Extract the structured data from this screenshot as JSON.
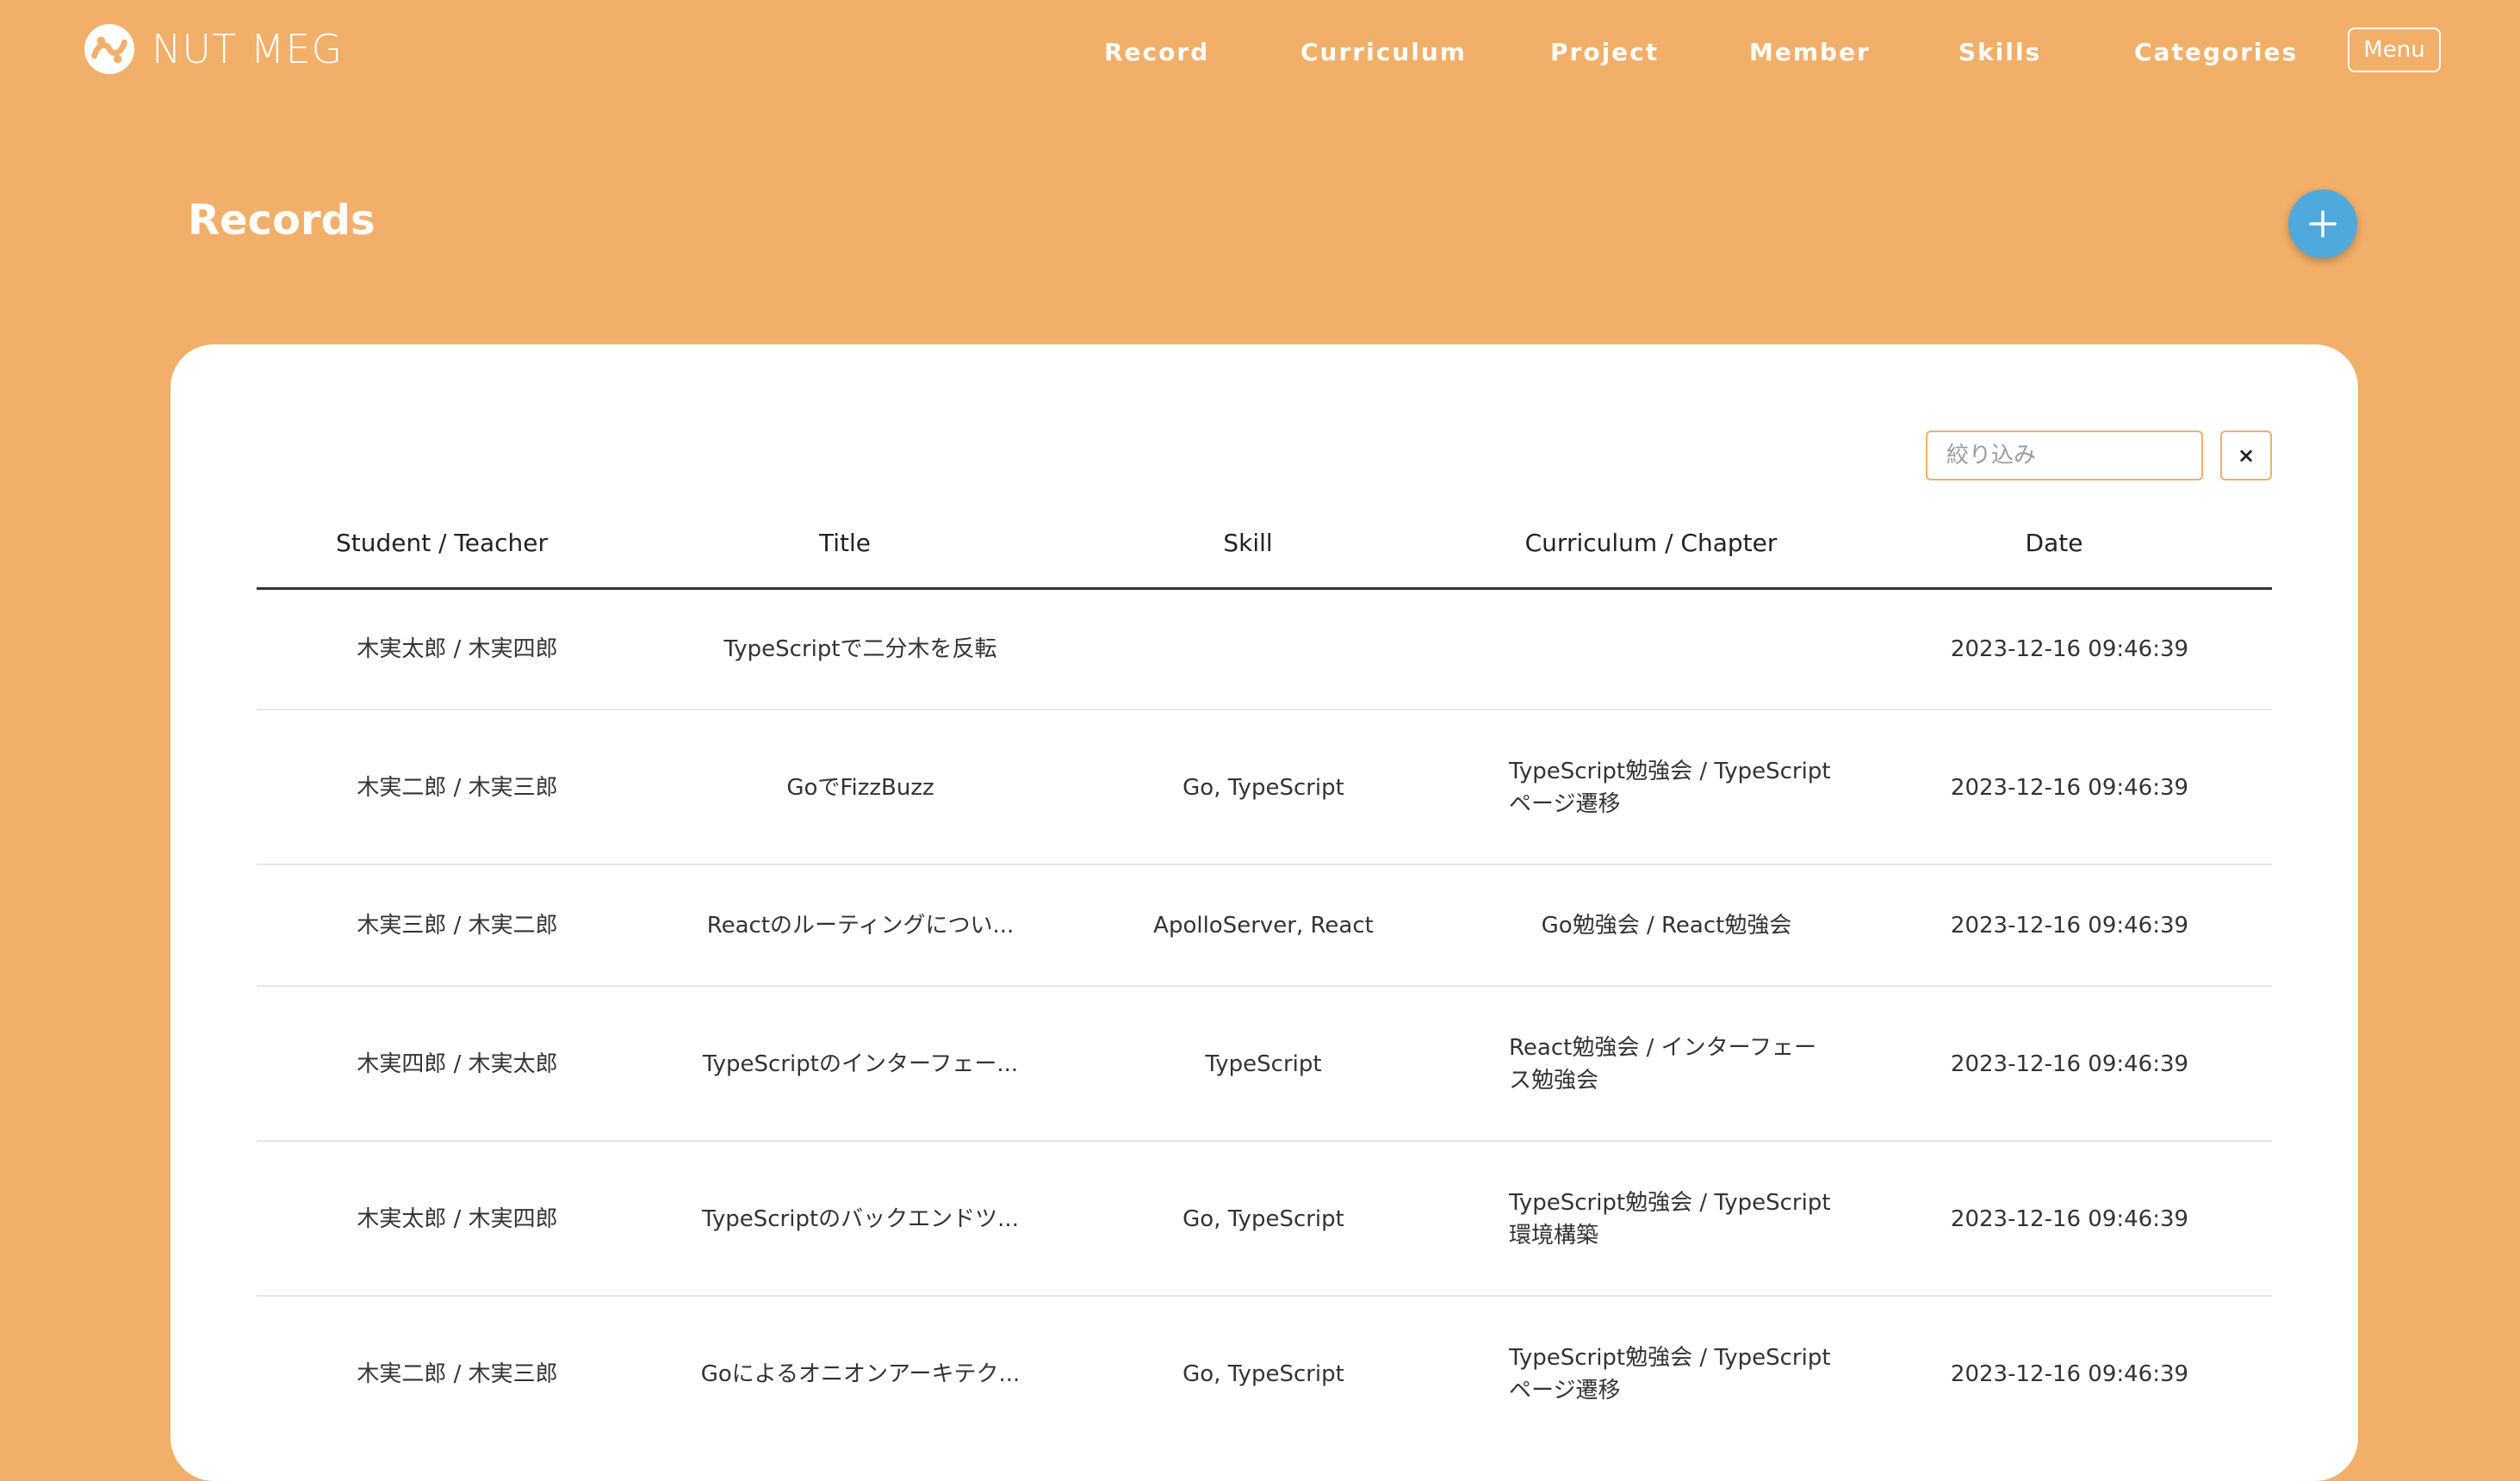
{
  "app": {
    "brand": "NUT MEG"
  },
  "nav": {
    "items": [
      {
        "label": "Record"
      },
      {
        "label": "Curriculum"
      },
      {
        "label": "Project"
      },
      {
        "label": "Member"
      },
      {
        "label": "Skills"
      },
      {
        "label": "Categories"
      }
    ],
    "menu_label": "Menu"
  },
  "page": {
    "title": "Records",
    "add_icon": "plus-icon"
  },
  "filter": {
    "placeholder": "絞り込み",
    "value": "",
    "clear_label": "×"
  },
  "table": {
    "headers": [
      "Student / Teacher",
      "Title",
      "Skill",
      "Curriculum / Chapter",
      "Date"
    ],
    "rows": [
      {
        "person": "木実太郎 / 木実四郎",
        "title": "TypeScriptで二分木を反転",
        "skill": "",
        "curriculum": [
          "",
          ""
        ],
        "date": "2023-12-16 09:46:39"
      },
      {
        "person": "木実二郎 / 木実三郎",
        "title": "GoでFizzBuzz",
        "skill": "Go, TypeScript",
        "curriculum": [
          "TypeScript勉強会 / TypeScript",
          "ページ遷移"
        ],
        "date": "2023-12-16 09:46:39"
      },
      {
        "person": "木実三郎 / 木実二郎",
        "title": "Reactのルーティングについ...",
        "skill": "ApolloServer, React",
        "curriculum": [
          "Go勉強会 / React勉強会",
          ""
        ],
        "date": "2023-12-16 09:46:39"
      },
      {
        "person": "木実四郎 / 木実太郎",
        "title": "TypeScriptのインターフェー...",
        "skill": "TypeScript",
        "curriculum": [
          "React勉強会 / インターフェー",
          "ス勉強会"
        ],
        "date": "2023-12-16 09:46:39"
      },
      {
        "person": "木実太郎 / 木実四郎",
        "title": "TypeScriptのバックエンドツ...",
        "skill": "Go, TypeScript",
        "curriculum": [
          "TypeScript勉強会 / TypeScript",
          "環境構築"
        ],
        "date": "2023-12-16 09:46:39"
      },
      {
        "person": "木実二郎 / 木実三郎",
        "title": "Goによるオニオンアーキテク...",
        "skill": "Go, TypeScript",
        "curriculum": [
          "TypeScript勉強会 / TypeScript",
          "ページ遷移"
        ],
        "date": "2023-12-16 09:46:39"
      }
    ]
  }
}
